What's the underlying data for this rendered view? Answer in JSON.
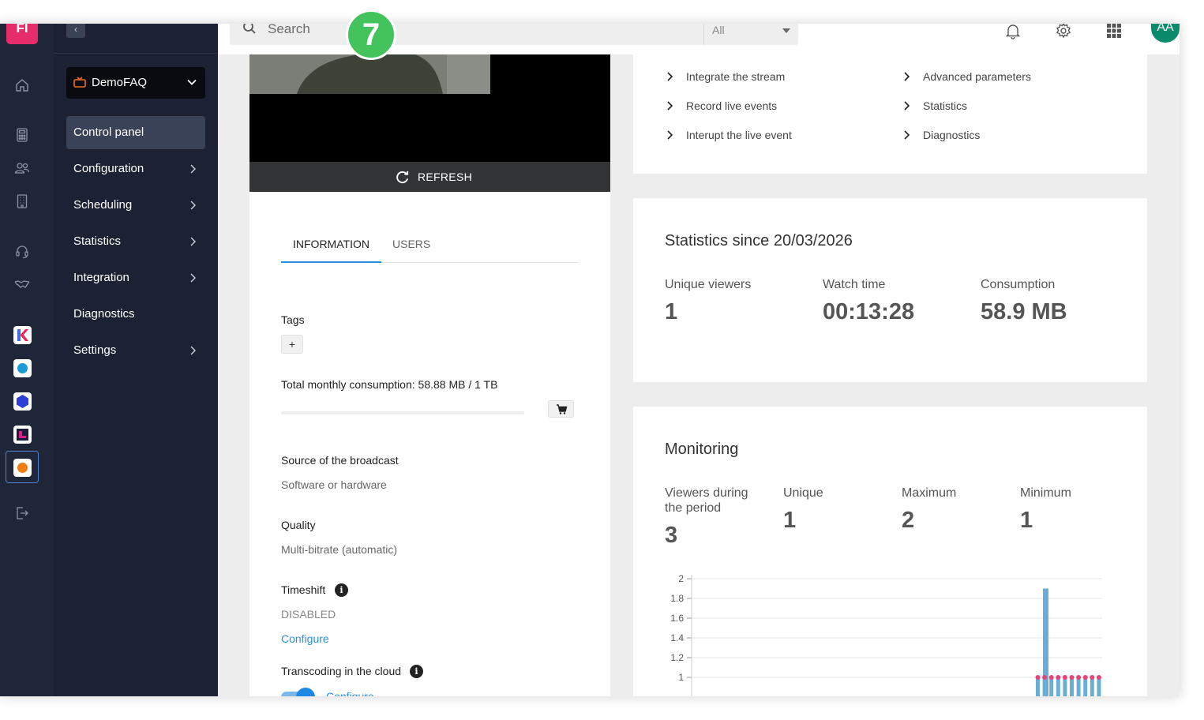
{
  "brand": {
    "initials": "FI",
    "color": "#e62c6a"
  },
  "rail": {
    "icons": [
      "home-icon",
      "calculator-icon",
      "users-icon",
      "building-icon",
      "headset-icon",
      "handshake-icon",
      "logout-icon"
    ],
    "apps": [
      {
        "name": "app-k",
        "color": "#e5285b"
      },
      {
        "name": "app-target",
        "color": "#1a9ad6"
      },
      {
        "name": "app-cube",
        "color": "#2b3fd6"
      },
      {
        "name": "app-l",
        "color": "#d81d86"
      },
      {
        "name": "app-stream",
        "color": "#f07d12"
      }
    ]
  },
  "nav": {
    "collapse_glyph": "‹",
    "service": {
      "name": "DemoFAQ"
    },
    "items": [
      {
        "label": "Control panel",
        "has_arrow": false,
        "active": true
      },
      {
        "label": "Configuration",
        "has_arrow": true,
        "active": false
      },
      {
        "label": "Scheduling",
        "has_arrow": true,
        "active": false
      },
      {
        "label": "Statistics",
        "has_arrow": true,
        "active": false
      },
      {
        "label": "Integration",
        "has_arrow": true,
        "active": false
      },
      {
        "label": "Diagnostics",
        "has_arrow": false,
        "active": false
      },
      {
        "label": "Settings",
        "has_arrow": true,
        "active": false
      }
    ]
  },
  "header": {
    "search_placeholder": "Search",
    "search_scope": "All",
    "avatar_initials": "AA",
    "avatar_color": "#0c8a6c"
  },
  "step_badge": "7",
  "player": {
    "refresh_label": "REFRESH"
  },
  "info": {
    "tabs": [
      {
        "label": "INFORMATION",
        "active": true
      },
      {
        "label": "USERS",
        "active": false
      }
    ],
    "tags_label": "Tags",
    "tags_add": "+",
    "consumption_label": "Total monthly consumption: 58.88 MB / 1 TB",
    "consumption_fraction": 6e-05,
    "source_label": "Source of the broadcast",
    "source_value": "Software or hardware",
    "quality_label": "Quality",
    "quality_value": "Multi-bitrate (automatic)",
    "timeshift_label": "Timeshift",
    "timeshift_value": "DISABLED",
    "timeshift_link": "Configure",
    "transcoding_label": "Transcoding in the cloud",
    "transcoding_enabled": true,
    "transcoding_link": "Configure"
  },
  "links": {
    "left": [
      "Integrate the stream",
      "Record live events",
      "Interupt the live event"
    ],
    "right": [
      "Advanced parameters",
      "Statistics",
      "Diagnostics"
    ]
  },
  "stats": {
    "title": "Statistics since 20/03/2026",
    "items": [
      {
        "label": "Unique viewers",
        "value": "1"
      },
      {
        "label": "Watch time",
        "value": "00:13:28"
      },
      {
        "label": "Consumption",
        "value": "58.9 MB"
      }
    ]
  },
  "monitoring": {
    "title": "Monitoring",
    "items": [
      {
        "label": "Viewers during the period",
        "value": "3"
      },
      {
        "label": "Unique",
        "value": "1"
      },
      {
        "label": "Maximum",
        "value": "2"
      },
      {
        "label": "Minimum",
        "value": "1"
      }
    ]
  },
  "chart_data": {
    "type": "bar",
    "y_ticks": [
      "2",
      "1.8",
      "1.6",
      "1.4",
      "1.2",
      "1"
    ],
    "ylim": [
      0.8,
      2
    ],
    "bar_color": "#6aaed6",
    "marker_color": "#e8437a",
    "grid": true,
    "series": [
      {
        "values": [
          1,
          1,
          1,
          1,
          1,
          1,
          1,
          1,
          1,
          1
        ]
      },
      {
        "values": [
          1.9
        ]
      }
    ]
  }
}
